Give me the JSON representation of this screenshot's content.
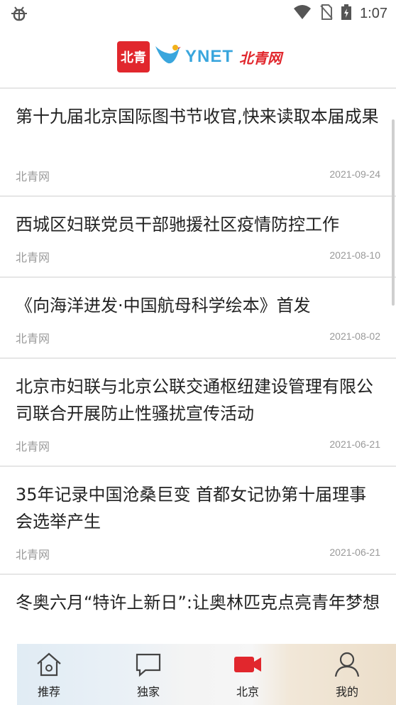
{
  "status": {
    "time": "1:07"
  },
  "header": {
    "logo_text": "北青",
    "brand_latin": "YNET",
    "brand_cn": "北青网"
  },
  "articles": [
    {
      "title": "第十九届北京国际图书节收官,快来读取本届成果",
      "source": "北青网",
      "date": "2021-09-24"
    },
    {
      "title": "西城区妇联党员干部驰援社区疫情防控工作",
      "source": "北青网",
      "date": "2021-08-10"
    },
    {
      "title": "《向海洋进发·中国航母科学绘本》首发",
      "source": "北青网",
      "date": "2021-08-02"
    },
    {
      "title": "北京市妇联与北京公联交通枢纽建设管理有限公司联合开展防止性骚扰宣传活动",
      "source": "北青网",
      "date": "2021-06-21"
    },
    {
      "title": "35年记录中国沧桑巨变 首都女记协第十届理事会选举产生",
      "source": "北青网",
      "date": "2021-06-21"
    },
    {
      "title": "冬奥六月“特许上新日”:让奥林匹克点亮青年梦想",
      "source": "",
      "date": ""
    }
  ],
  "tabs": [
    {
      "label": "推荐",
      "icon": "home-icon"
    },
    {
      "label": "独家",
      "icon": "chat-bubble-icon"
    },
    {
      "label": "北京",
      "icon": "video-camera-icon"
    },
    {
      "label": "我的",
      "icon": "user-icon"
    }
  ],
  "colors": {
    "accent": "#e1272d",
    "brand_blue": "#3aa6dd"
  }
}
